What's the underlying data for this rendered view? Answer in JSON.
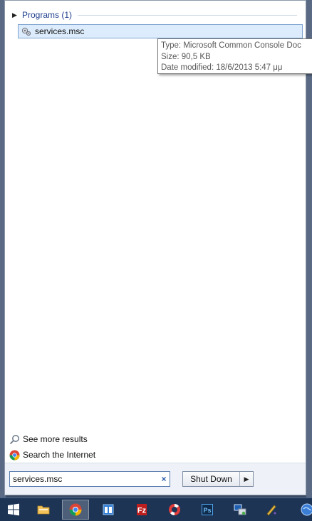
{
  "start_menu": {
    "group": {
      "title": "Programs (1)"
    },
    "results": [
      {
        "label": "services.msc",
        "icon": "gears-icon"
      }
    ],
    "tooltip": {
      "type_line": "Type: Microsoft Common Console Doc",
      "size_line": "Size: 90,5 KB",
      "date_line": "Date modified: 18/6/2013 5:47 μμ"
    },
    "see_more": "See more results",
    "search_internet": "Search the Internet",
    "search": {
      "value": "services.msc",
      "clear_glyph": "×"
    },
    "shutdown": {
      "label": "Shut Down",
      "arrow_glyph": "▶"
    }
  },
  "taskbar": {
    "items": [
      {
        "name": "start-button",
        "icon": "windows-logo-icon"
      },
      {
        "name": "file-explorer",
        "icon": "folder-icon"
      },
      {
        "name": "chrome",
        "icon": "chrome-icon",
        "active": true
      },
      {
        "name": "app-blue",
        "icon": "window-icon"
      },
      {
        "name": "filezilla",
        "icon": "filezilla-icon"
      },
      {
        "name": "help-app",
        "icon": "lifebuoy-icon"
      },
      {
        "name": "photoshop",
        "icon": "photoshop-icon"
      },
      {
        "name": "network-app",
        "icon": "network-icon"
      },
      {
        "name": "pen-app",
        "icon": "pen-icon"
      },
      {
        "name": "globe-app",
        "icon": "globe-icon"
      }
    ]
  }
}
